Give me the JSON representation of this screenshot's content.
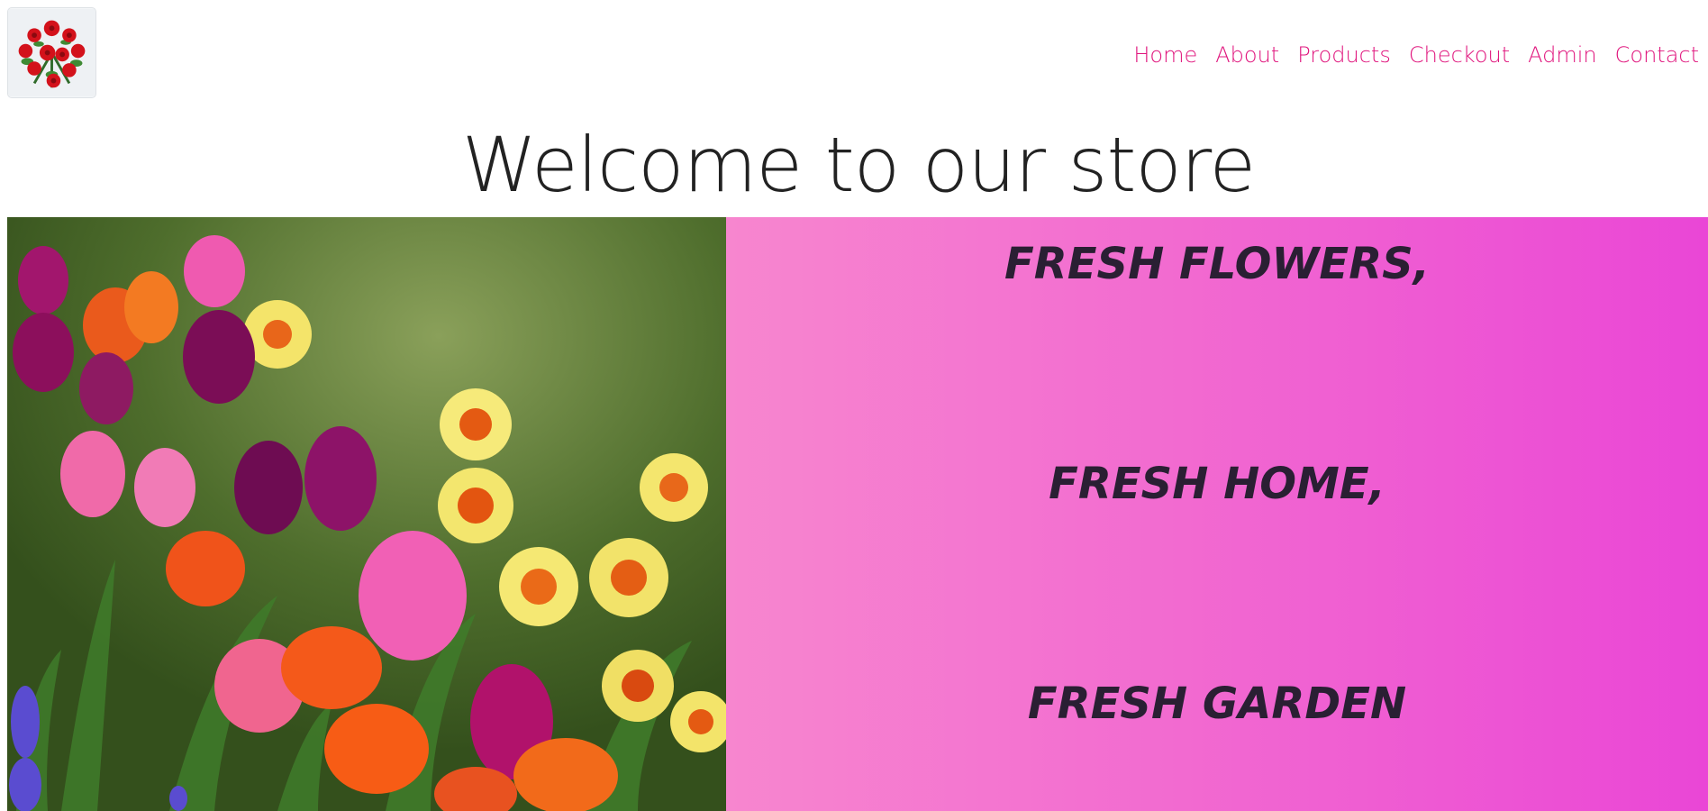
{
  "header": {
    "logo_icon": "rose-bouquet-icon",
    "nav": [
      "Home",
      "About",
      "Products",
      "Checkout",
      "Admin",
      "Contact"
    ],
    "nav_color": "#e0157d"
  },
  "main": {
    "title": "Welcome to our store",
    "hero": {
      "image_icon": "tulip-garden-photo",
      "taglines": [
        "FRESH FLOWERS,",
        "FRESH HOME,",
        "FRESH GARDEN"
      ],
      "gradient_colors": [
        "#f786cf",
        "#ea46d6"
      ]
    }
  }
}
